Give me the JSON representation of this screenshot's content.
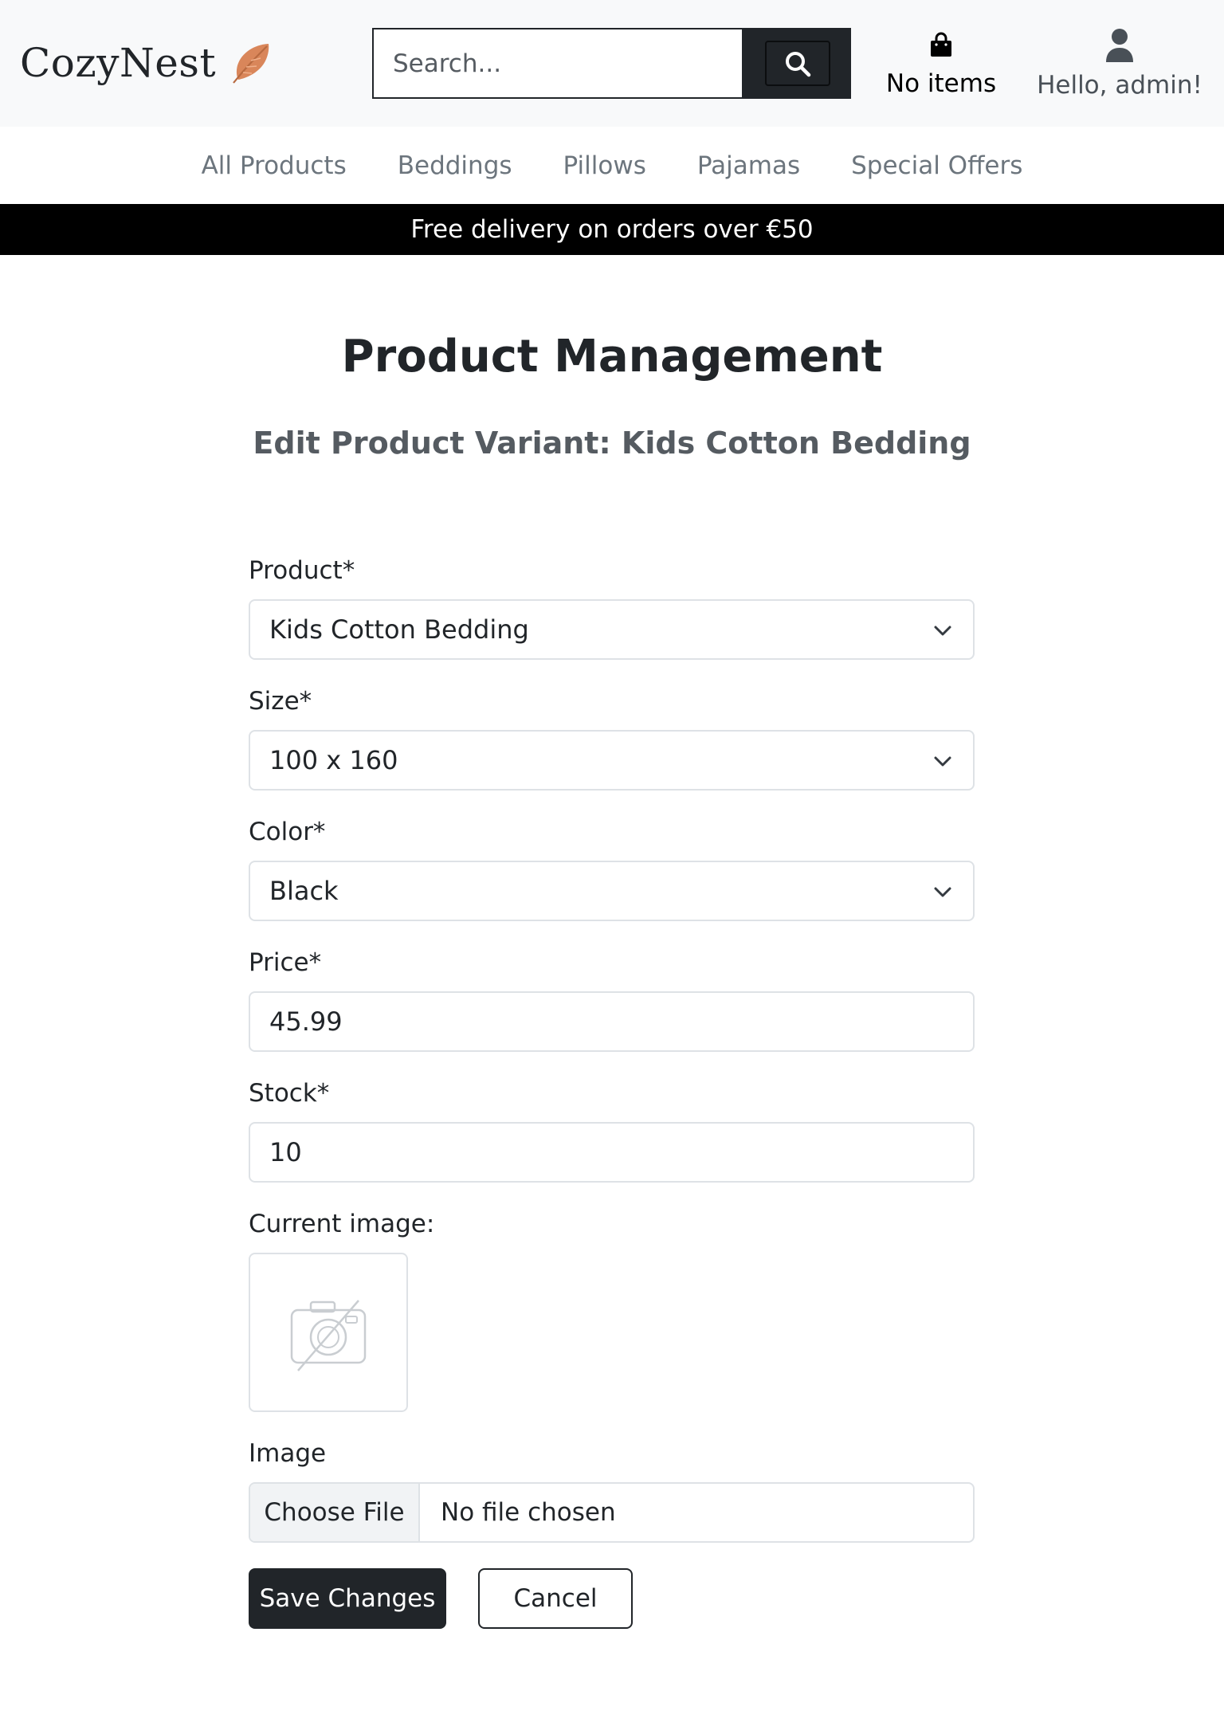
{
  "header": {
    "brand": "CozyNest",
    "search": {
      "placeholder": "Search..."
    },
    "cart": {
      "label": "No items"
    },
    "account": {
      "label": "Hello, admin!"
    }
  },
  "nav": {
    "items": [
      {
        "label": "All Products"
      },
      {
        "label": "Beddings"
      },
      {
        "label": "Pillows"
      },
      {
        "label": "Pajamas"
      },
      {
        "label": "Special Offers"
      }
    ]
  },
  "banner": {
    "text": "Free delivery on orders over €50"
  },
  "page": {
    "title": "Product Management",
    "subtitle": "Edit Product Variant: Kids Cotton Bedding"
  },
  "form": {
    "product": {
      "label": "Product*",
      "value": "Kids Cotton Bedding"
    },
    "size": {
      "label": "Size*",
      "value": "100 x 160"
    },
    "color": {
      "label": "Color*",
      "value": "Black"
    },
    "price": {
      "label": "Price*",
      "value": "45.99"
    },
    "stock": {
      "label": "Stock*",
      "value": "10"
    },
    "current_image": {
      "label": "Current image:"
    },
    "image": {
      "label": "Image",
      "button": "Choose File",
      "status": "No file chosen"
    },
    "save_label": "Save Changes",
    "cancel_label": "Cancel"
  },
  "colors": {
    "header_bg": "#f8f9fa",
    "dark": "#212529",
    "banner_bg": "#000000",
    "feather": "#d9865a"
  },
  "icons": [
    "feather-icon",
    "search-icon",
    "shopping-bag-icon",
    "user-icon",
    "chevron-down-icon",
    "no-image-icon"
  ]
}
